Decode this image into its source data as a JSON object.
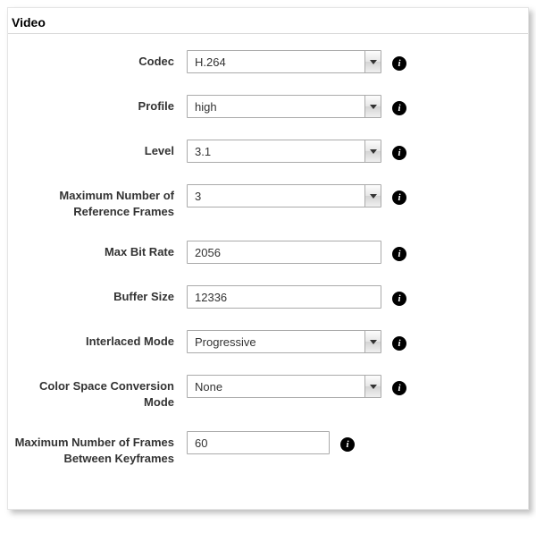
{
  "section_title": "Video",
  "rows": [
    {
      "key": "codec",
      "label": "Codec",
      "type": "select",
      "value": "H.264"
    },
    {
      "key": "profile",
      "label": "Profile",
      "type": "select",
      "value": "high"
    },
    {
      "key": "level",
      "label": "Level",
      "type": "select",
      "value": "3.1"
    },
    {
      "key": "ref_frames",
      "label": "Maximum Number of Reference Frames",
      "type": "select",
      "value": "3"
    },
    {
      "key": "max_bitrate",
      "label": "Max Bit Rate",
      "type": "text",
      "value": "2056"
    },
    {
      "key": "buffer_size",
      "label": "Buffer Size",
      "type": "text",
      "value": "12336"
    },
    {
      "key": "interlaced",
      "label": "Interlaced Mode",
      "type": "select",
      "value": "Progressive"
    },
    {
      "key": "colorspace",
      "label": "Color Space Conversion Mode",
      "type": "select",
      "value": "None"
    },
    {
      "key": "keyframes",
      "label": "Maximum Number of Frames Between Keyframes",
      "type": "text",
      "value": "60",
      "narrow": true
    }
  ]
}
